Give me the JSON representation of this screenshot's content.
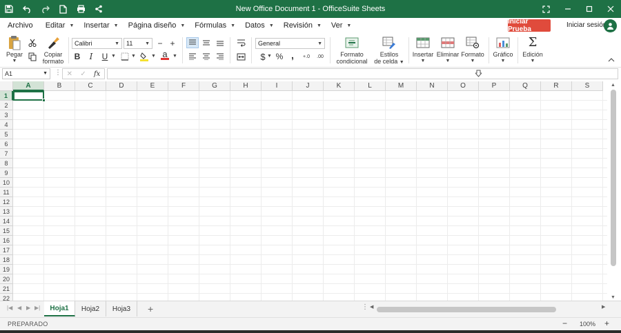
{
  "window": {
    "title": "New Office Document 1 - OfficeSuite Sheets",
    "brand_color": "#1e7145"
  },
  "quick_access": {
    "icons": [
      "save-icon",
      "undo-icon",
      "redo-icon",
      "new-document-icon",
      "print-icon",
      "share-icon"
    ]
  },
  "menu": {
    "items": [
      {
        "label": "Archivo",
        "dropdown": false
      },
      {
        "label": "Editar",
        "dropdown": true
      },
      {
        "label": "Insertar",
        "dropdown": true
      },
      {
        "label": "Página diseño",
        "dropdown": true
      },
      {
        "label": "Fórmulas",
        "dropdown": true
      },
      {
        "label": "Datos",
        "dropdown": true
      },
      {
        "label": "Revisión",
        "dropdown": true
      },
      {
        "label": "Ver",
        "dropdown": true
      }
    ],
    "trial_button": "Iniciar Prueba",
    "trial_color": "#e04b3c",
    "signin": "Iniciar sesión"
  },
  "ribbon": {
    "paste": "Pegar",
    "copy_format_1": "Copiar",
    "copy_format_2": "formato",
    "font_name": "Calibri",
    "font_size": "11",
    "number_format": "General",
    "conditional_format_1": "Formato",
    "conditional_format_2": "condicional",
    "cell_styles_1": "Estilos",
    "cell_styles_2": "de celda",
    "insert": "Insertar",
    "delete": "Eliminar",
    "format": "Formato",
    "chart": "Gráfico",
    "editing": "Edición",
    "bold": "B",
    "italic": "I",
    "underline": "U",
    "currency": "$",
    "percent": "%",
    "comma": ",",
    "inc_decimal": "+.0",
    "dec_decimal": ".00",
    "font_color_letter": "a"
  },
  "formula_bar": {
    "name_box": "A1",
    "fx": "fx",
    "value": ""
  },
  "grid": {
    "columns": [
      "A",
      "B",
      "C",
      "D",
      "E",
      "F",
      "G",
      "H",
      "I",
      "J",
      "K",
      "L",
      "M",
      "N",
      "O",
      "P",
      "Q",
      "R",
      "S"
    ],
    "rows": [
      "1",
      "2",
      "3",
      "4",
      "5",
      "6",
      "7",
      "8",
      "9",
      "10",
      "11",
      "12",
      "13",
      "14",
      "15",
      "16",
      "17",
      "18",
      "19",
      "20",
      "21",
      "22"
    ],
    "selected_cell": "A1"
  },
  "sheets": {
    "tabs": [
      "Hoja1",
      "Hoja2",
      "Hoja3"
    ],
    "active": "Hoja1"
  },
  "status": {
    "text": "PREPARADO",
    "zoom": "100%"
  }
}
